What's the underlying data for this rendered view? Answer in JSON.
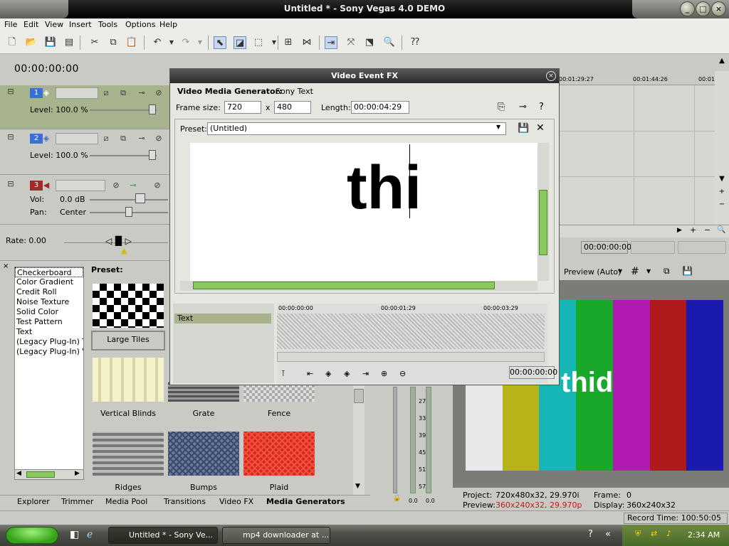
{
  "window": {
    "title": "Untitled * - Sony Vegas 4.0 DEMO"
  },
  "menu": [
    "File",
    "Edit",
    "View",
    "Insert",
    "Tools",
    "Options",
    "Help"
  ],
  "timeline": {
    "cursor_time": "00:00:00:00",
    "ruler_labels": [
      "00:01:29:27",
      "00:01:44:26",
      "00:01"
    ],
    "end_time": "00:00:00:00"
  },
  "tracks": [
    {
      "number": "1",
      "level_label": "Level: 100.0 %"
    },
    {
      "number": "2",
      "level_label": "Level: 100.0 %"
    },
    {
      "number": "3",
      "vol_label": "Vol:",
      "vol_value": "0.0 dB",
      "pan_label": "Pan:",
      "pan_value": "Center"
    }
  ],
  "rate_label": "Rate: 0.00",
  "media_generators": {
    "preset_heading": "Preset:",
    "list": [
      "Checkerboard",
      "Color Gradient",
      "Credit Roll",
      "Noise Texture",
      "Solid Color",
      "Test Pattern",
      "Text",
      "(Legacy Plug-In) Tex",
      "(Legacy Plug-In) Vid"
    ],
    "presets": [
      "Large Tiles",
      "Vertical Blinds",
      "Grate",
      "Fence",
      "Ridges",
      "Bumps",
      "Plaid"
    ]
  },
  "bottom_tabs": [
    "Explorer",
    "Trimmer",
    "Media Pool",
    "Transitions",
    "Video FX",
    "Media Generators"
  ],
  "vfx_dialog": {
    "title": "Video Event FX",
    "generator_label": "Video Media Generator:",
    "generator_name": "Sony Text",
    "frame_size_label": "Frame size:",
    "frame_width": "720",
    "x_label": "x",
    "frame_height": "480",
    "length_label": "Length:",
    "length_value": "00:00:04:29",
    "preset_label": "Preset:",
    "preset_value": "(Untitled)",
    "canvas_text": "thi",
    "keyframe_track": "Text",
    "kf_times": [
      "00:00:00:00",
      "00:00:01:29",
      "00:00:03:29"
    ],
    "kf_current": "00:00:00:00"
  },
  "preview": {
    "mode_label": "Preview (Auto)",
    "overlay_text": "thid",
    "bar_colors": [
      "#e8e8e8",
      "#b7b41a",
      "#17b6b6",
      "#1aa82a",
      "#b01ab0",
      "#b01a1a",
      "#1a1ab0"
    ],
    "project_label": "Project:",
    "project_value": "720x480x32, 29.970i",
    "preview_label": "Preview:",
    "preview_value": "360x240x32, 29.970p",
    "frame_label": "Frame:",
    "frame_value": "0",
    "display_label": "Display:",
    "display_value": "360x240x32"
  },
  "meter": {
    "ticks": [
      "27",
      "33",
      "39",
      "45",
      "51",
      "57"
    ],
    "left_value": "0.0",
    "right_value": "0.0"
  },
  "status": {
    "record_time": "Record Time: 100:50:05"
  },
  "taskbar": {
    "tasks": [
      "Untitled * - Sony Ve...",
      "mp4 downloader at ..."
    ],
    "clock": "2:34 AM"
  }
}
